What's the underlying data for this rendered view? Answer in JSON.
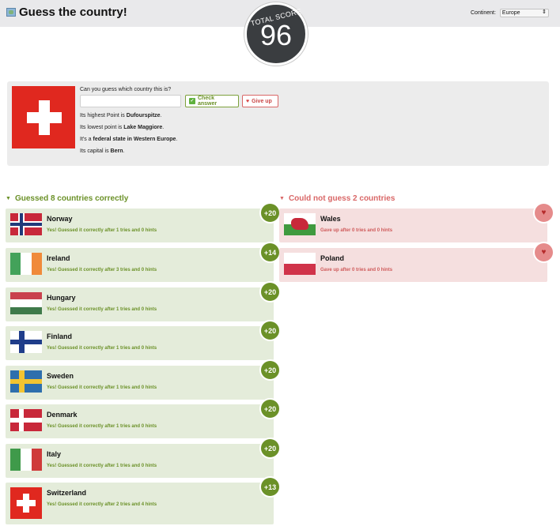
{
  "header": {
    "title": "Guess the country!",
    "continent_label": "Continent:",
    "continent_value": "Europe"
  },
  "score": {
    "label": "TOTAL SCORE",
    "value": "96"
  },
  "quiz": {
    "question": "Can you guess which country this is?",
    "answer_placeholder": "",
    "check_label": "Check answer",
    "giveup_label": "Give up",
    "hints": [
      {
        "pre": "Its highest Point is ",
        "bold": "Dufourspitze",
        "post": "."
      },
      {
        "pre": "Its lowest point is ",
        "bold": "Lake Maggiore",
        "post": "."
      },
      {
        "pre": "It's a ",
        "bold": "federal state in Western Europe",
        "post": "."
      },
      {
        "pre": "Its capital is ",
        "bold": "Bern",
        "post": "."
      }
    ]
  },
  "correct": {
    "title": "Guessed 8 countries correctly",
    "items": [
      {
        "name": "Norway",
        "message": "Yes! Guessed it correctly after 1 tries and 0 hints",
        "points": "+20"
      },
      {
        "name": "Ireland",
        "message": "Yes! Guessed it correctly after 3 tries and 0 hints",
        "points": "+14"
      },
      {
        "name": "Hungary",
        "message": "Yes! Guessed it correctly after 1 tries and 0 hints",
        "points": "+20"
      },
      {
        "name": "Finland",
        "message": "Yes! Guessed it correctly after 1 tries and 0 hints",
        "points": "+20"
      },
      {
        "name": "Sweden",
        "message": "Yes! Guessed it correctly after 1 tries and 0 hints",
        "points": "+20"
      },
      {
        "name": "Denmark",
        "message": "Yes! Guessed it correctly after 1 tries and 0 hints",
        "points": "+20"
      },
      {
        "name": "Italy",
        "message": "Yes! Guessed it correctly after 1 tries and 0 hints",
        "points": "+20"
      },
      {
        "name": "Switzerland",
        "message": "Yes! Guessed it correctly after 2 tries and 4 hints",
        "points": "+13"
      }
    ]
  },
  "failed": {
    "title": "Could not guess 2 countries",
    "items": [
      {
        "name": "Wales",
        "message": "Gave up after 0 tries and 0 hints"
      },
      {
        "name": "Poland",
        "message": "Gave up after 0 tries and 0 hints"
      }
    ]
  },
  "colors": {
    "success": "#6b9128",
    "danger": "#d96767",
    "score_bg": "#3a3d40"
  },
  "icons": {
    "title": "map-icon",
    "check": "check-icon",
    "give_up": "broken-heart-icon"
  }
}
